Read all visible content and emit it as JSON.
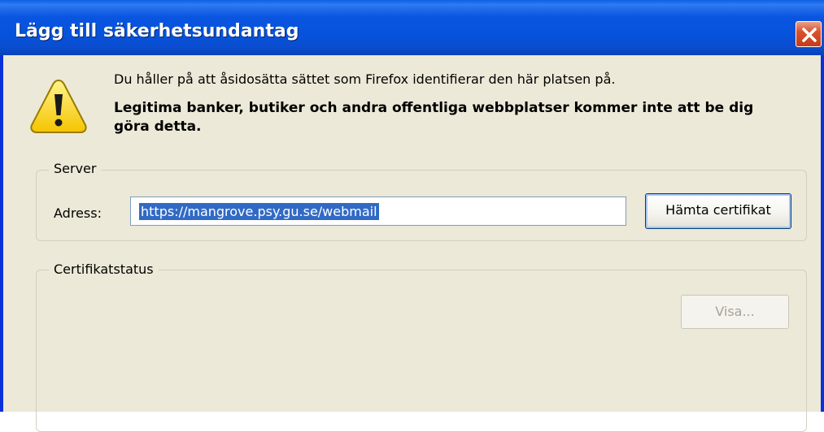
{
  "window": {
    "title": "Lägg till säkerhetsundantag",
    "close_icon": "close-icon"
  },
  "message": {
    "icon": "warning-icon",
    "line1": "Du håller på att åsidosätta sättet som Firefox identifierar den här platsen på.",
    "line2": "Legitima banker, butiker och andra offentliga webbplatser kommer inte att be dig göra detta."
  },
  "server": {
    "legend": "Server",
    "address_label": "Adress:",
    "address_value": "https://mangrove.psy.gu.se/webmail",
    "fetch_button": "Hämta certifikat"
  },
  "certificate": {
    "legend": "Certifikatstatus",
    "view_button": "Visa..."
  },
  "colors": {
    "titlebar": "#0a55e0",
    "dialog_bg": "#ece9d8",
    "selection": "#316ac5"
  }
}
